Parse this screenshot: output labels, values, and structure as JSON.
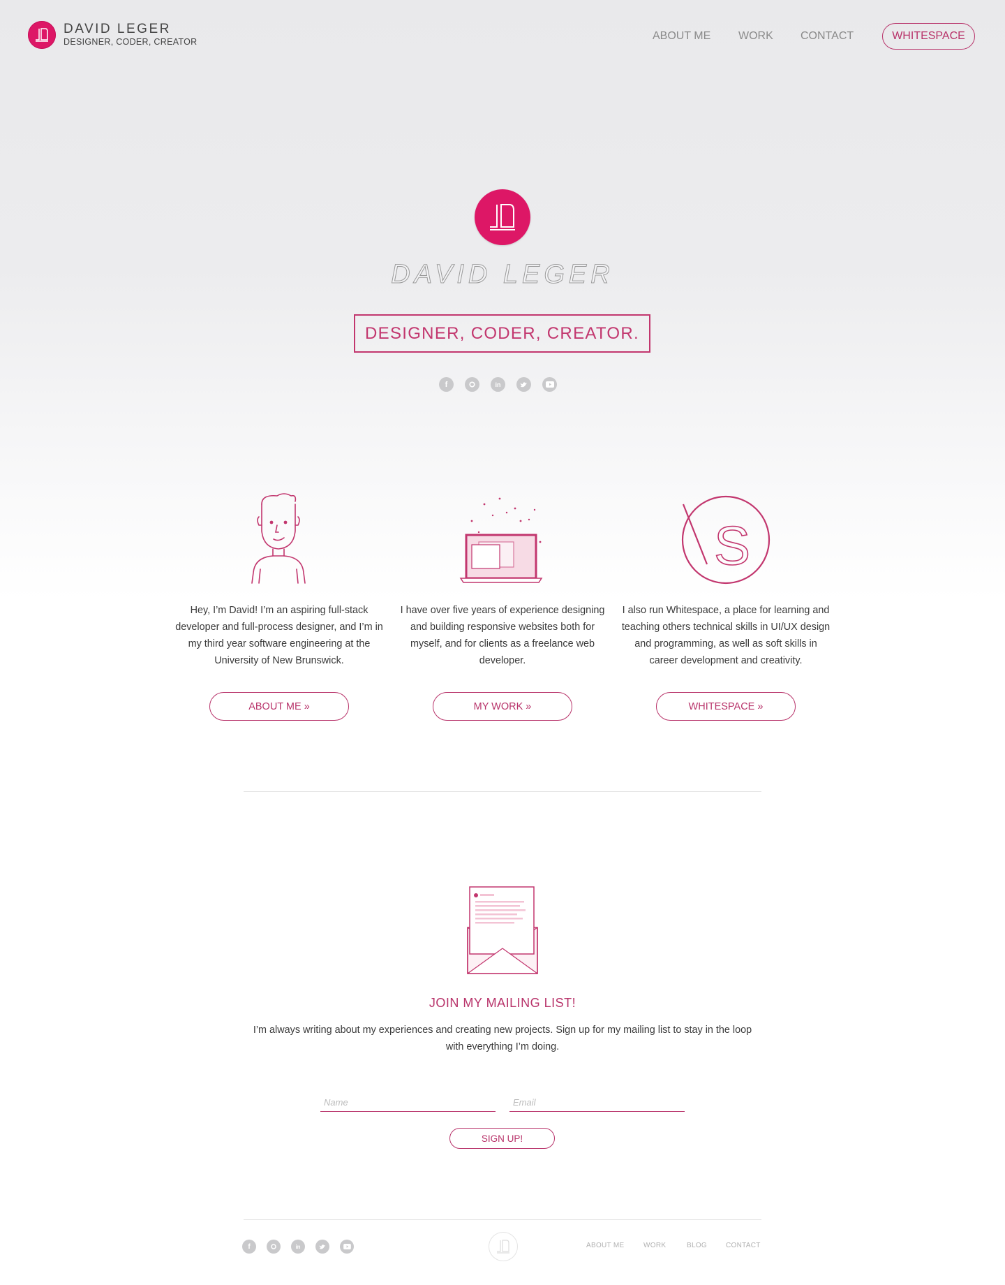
{
  "header": {
    "name": "DAVID LEGER",
    "tagline": "DESIGNER, CODER, CREATOR",
    "nav": [
      {
        "label": "ABOUT ME"
      },
      {
        "label": "WORK"
      },
      {
        "label": "CONTACT"
      }
    ],
    "cta_label": "WHITESPACE"
  },
  "hero": {
    "name": "DAVID LEGER",
    "tagline": "DESIGNER, CODER, CREATOR.",
    "social_icons": [
      "facebook-icon",
      "github-icon",
      "linkedin-icon",
      "twitter-icon",
      "youtube-icon"
    ]
  },
  "features": [
    {
      "icon": "avatar-illustration",
      "text": "Hey, I’m David! I’m an aspiring full-stack developer and full-process designer, and I’m in my third year software engineering at the University of New Brunswick.",
      "button": "ABOUT ME  »"
    },
    {
      "icon": "laptop-illustration",
      "text": "I have over five years of experience designing and building responsive websites both for myself, and for clients as a freelance web developer.",
      "button": "MY WORK  »"
    },
    {
      "icon": "whitespace-logo",
      "text": "I also run Whitespace, a place for learning and teaching others technical skills in UI/UX design and programming, as well as soft skills in career development and creativity.",
      "button": "WHITESPACE  »"
    }
  ],
  "mailing": {
    "title": "JOIN MY MAILING LIST!",
    "description": "I’m always writing about my experiences and creating new projects. Sign up for my mailing list to stay in the loop with everything I’m doing.",
    "name_placeholder": "Name",
    "email_placeholder": "Email",
    "button": "SIGN UP!"
  },
  "footer": {
    "links": [
      "ABOUT ME",
      "WORK",
      "BLOG",
      "CONTACT"
    ]
  },
  "colors": {
    "accent": "#b8336a",
    "logo": "#dd1766",
    "icon_gray": "#c9c9cb"
  }
}
